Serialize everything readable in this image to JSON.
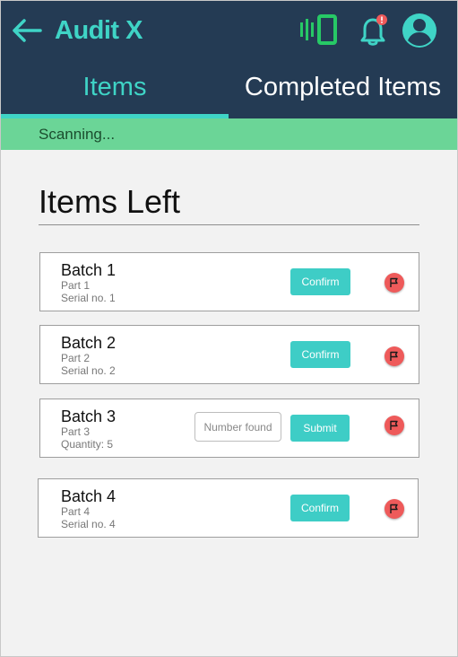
{
  "app": {
    "title": "Audit X"
  },
  "tabs": [
    {
      "label": "Items",
      "active": true
    },
    {
      "label": "Completed Items",
      "active": false
    }
  ],
  "status": {
    "text": "Scanning..."
  },
  "section": {
    "title": "Items Left"
  },
  "items": [
    {
      "title": "Batch 1",
      "sub1": "Part 1",
      "sub2": "Serial no. 1",
      "action_label": "Confirm"
    },
    {
      "title": "Batch 2",
      "sub1": "Part 2",
      "sub2": "Serial no. 2",
      "action_label": "Confirm"
    },
    {
      "title": "Batch 3",
      "sub1": "Part 3",
      "sub2": "Quantity: 5",
      "input_placeholder": "Number found",
      "action_label": "Submit"
    },
    {
      "title": "Batch 4",
      "sub1": "Part 4",
      "sub2": "Serial no. 4",
      "action_label": "Confirm"
    }
  ],
  "icons": {
    "back": "arrow-left-icon",
    "scanner": "barcode-scanner-icon",
    "notifications": "bell-icon",
    "account": "account-circle-icon",
    "flag": "flag-icon"
  },
  "colors": {
    "header_bg": "#243b54",
    "accent": "#3fd4c6",
    "status_bg": "#6bd597",
    "flag_bg": "#ee5a5a",
    "button_bg": "#3ecdc6",
    "scanner_green": "#27c966"
  }
}
